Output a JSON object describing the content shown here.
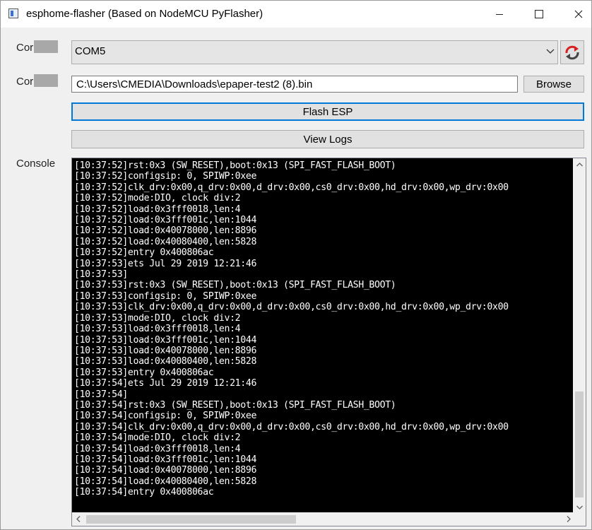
{
  "window": {
    "title": "esphome-flasher (Based on NodeMCU PyFlasher)",
    "icons": {
      "app": "app-window-icon",
      "minimize": "minimize-icon",
      "maximize": "maximize-icon",
      "close": "close-icon"
    }
  },
  "form": {
    "serial_label": "Cor",
    "firmware_label": "Cor",
    "serial_port_value": "COM5",
    "firmware_path_value": "C:\\Users\\CMEDIA\\Downloads\\epaper-test2 (8).bin",
    "browse_label": "Browse",
    "flash_label": "Flash ESP",
    "view_logs_label": "View Logs",
    "console_label": "Console",
    "reload_icon": "reload-icon",
    "combo_arrow_icon": "chevron-down-icon"
  },
  "console": {
    "lines": [
      "[10:37:52]rst:0x3 (SW_RESET),boot:0x13 (SPI_FAST_FLASH_BOOT)",
      "[10:37:52]configsip: 0, SPIWP:0xee",
      "[10:37:52]clk_drv:0x00,q_drv:0x00,d_drv:0x00,cs0_drv:0x00,hd_drv:0x00,wp_drv:0x00",
      "[10:37:52]mode:DIO, clock div:2",
      "[10:37:52]load:0x3fff0018,len:4",
      "[10:37:52]load:0x3fff001c,len:1044",
      "[10:37:52]load:0x40078000,len:8896",
      "[10:37:52]load:0x40080400,len:5828",
      "[10:37:52]entry 0x400806ac",
      "[10:37:53]ets Jul 29 2019 12:21:46",
      "[10:37:53]",
      "[10:37:53]rst:0x3 (SW_RESET),boot:0x13 (SPI_FAST_FLASH_BOOT)",
      "[10:37:53]configsip: 0, SPIWP:0xee",
      "[10:37:53]clk_drv:0x00,q_drv:0x00,d_drv:0x00,cs0_drv:0x00,hd_drv:0x00,wp_drv:0x00",
      "[10:37:53]mode:DIO, clock div:2",
      "[10:37:53]load:0x3fff0018,len:4",
      "[10:37:53]load:0x3fff001c,len:1044",
      "[10:37:53]load:0x40078000,len:8896",
      "[10:37:53]load:0x40080400,len:5828",
      "[10:37:53]entry 0x400806ac",
      "[10:37:54]ets Jul 29 2019 12:21:46",
      "[10:37:54]",
      "[10:37:54]rst:0x3 (SW_RESET),boot:0x13 (SPI_FAST_FLASH_BOOT)",
      "[10:37:54]configsip: 0, SPIWP:0xee",
      "[10:37:54]clk_drv:0x00,q_drv:0x00,d_drv:0x00,cs0_drv:0x00,hd_drv:0x00,wp_drv:0x00",
      "[10:37:54]mode:DIO, clock div:2",
      "[10:37:54]load:0x3fff0018,len:4",
      "[10:37:54]load:0x3fff001c,len:1044",
      "[10:37:54]load:0x40078000,len:8896",
      "[10:37:54]load:0x40080400,len:5828",
      "[10:37:54]entry 0x400806ac"
    ]
  },
  "colors": {
    "window_bg": "#f0f0f0",
    "console_bg": "#000000",
    "console_fg": "#ffffff",
    "focus_border": "#0078d7",
    "reload_icon_color": "#d62020"
  }
}
